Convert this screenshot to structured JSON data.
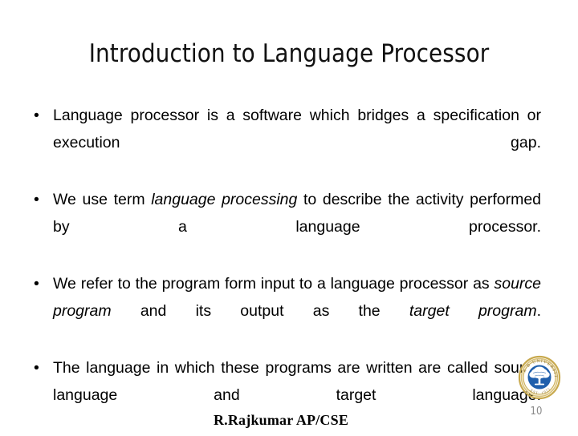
{
  "slide": {
    "title": "Introduction to Language Processor",
    "page_number": "10",
    "footer_author": "R.Rajkumar AP/CSE",
    "background_color": "#ffffff",
    "text_color": "#000000",
    "page_number_color": "#8a8a8a"
  },
  "bullets": [
    {
      "marker": "•",
      "text": "Language processor is a software which bridges a specification or execution gap.",
      "segments": [
        {
          "text": "Language processor is a software which bridges a specification or execution gap.",
          "italic": false
        }
      ]
    },
    {
      "marker": "•",
      "text": "We use term language processing to describe the activity performed by a language processor.",
      "segments": [
        {
          "text": "We use term ",
          "italic": false
        },
        {
          "text": "language processing",
          "italic": true
        },
        {
          "text": " to describe the activity performed by a language processor.",
          "italic": false
        }
      ]
    },
    {
      "marker": "•",
      "text": "We refer to the program form input to a language processor as source program and its output as the target program.",
      "segments": [
        {
          "text": "We refer to the program form input to a language processor as ",
          "italic": false
        },
        {
          "text": "source program",
          "italic": true
        },
        {
          "text": " and its output as the ",
          "italic": false
        },
        {
          "text": "target program",
          "italic": true
        },
        {
          "text": ".",
          "italic": false
        }
      ]
    },
    {
      "marker": "•",
      "text": "The language in which these programs are written are called source language and target language.",
      "segments": [
        {
          "text": "The language in which these programs are written are called source language and target language.",
          "italic": false
        }
      ]
    }
  ],
  "logo": {
    "name": "university-seal-logo",
    "ring_color": "#c8a94e",
    "ring_inner_color": "#f2e6c2",
    "disc_color": "#1f5fac",
    "tree_color": "#ffffff",
    "ring_text_top": "R B UNIVERSITY",
    "ring_text_bottom": "EST. 1971"
  }
}
